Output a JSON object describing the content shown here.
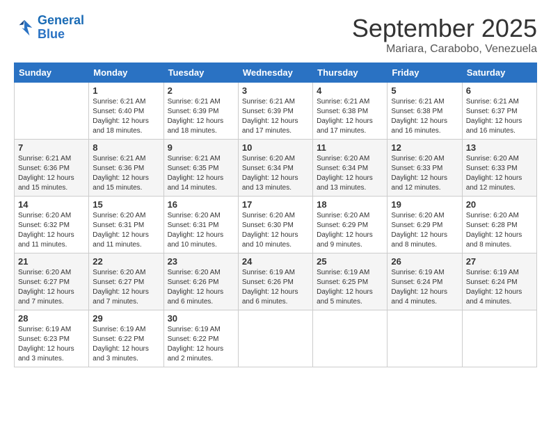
{
  "logo": {
    "line1": "General",
    "line2": "Blue"
  },
  "header": {
    "month": "September 2025",
    "location": "Mariara, Carabobo, Venezuela"
  },
  "columns": [
    "Sunday",
    "Monday",
    "Tuesday",
    "Wednesday",
    "Thursday",
    "Friday",
    "Saturday"
  ],
  "weeks": [
    [
      {
        "day": "",
        "info": ""
      },
      {
        "day": "1",
        "info": "Sunrise: 6:21 AM\nSunset: 6:40 PM\nDaylight: 12 hours\nand 18 minutes."
      },
      {
        "day": "2",
        "info": "Sunrise: 6:21 AM\nSunset: 6:39 PM\nDaylight: 12 hours\nand 18 minutes."
      },
      {
        "day": "3",
        "info": "Sunrise: 6:21 AM\nSunset: 6:39 PM\nDaylight: 12 hours\nand 17 minutes."
      },
      {
        "day": "4",
        "info": "Sunrise: 6:21 AM\nSunset: 6:38 PM\nDaylight: 12 hours\nand 17 minutes."
      },
      {
        "day": "5",
        "info": "Sunrise: 6:21 AM\nSunset: 6:38 PM\nDaylight: 12 hours\nand 16 minutes."
      },
      {
        "day": "6",
        "info": "Sunrise: 6:21 AM\nSunset: 6:37 PM\nDaylight: 12 hours\nand 16 minutes."
      }
    ],
    [
      {
        "day": "7",
        "info": "Sunrise: 6:21 AM\nSunset: 6:36 PM\nDaylight: 12 hours\nand 15 minutes."
      },
      {
        "day": "8",
        "info": "Sunrise: 6:21 AM\nSunset: 6:36 PM\nDaylight: 12 hours\nand 15 minutes."
      },
      {
        "day": "9",
        "info": "Sunrise: 6:21 AM\nSunset: 6:35 PM\nDaylight: 12 hours\nand 14 minutes."
      },
      {
        "day": "10",
        "info": "Sunrise: 6:20 AM\nSunset: 6:34 PM\nDaylight: 12 hours\nand 13 minutes."
      },
      {
        "day": "11",
        "info": "Sunrise: 6:20 AM\nSunset: 6:34 PM\nDaylight: 12 hours\nand 13 minutes."
      },
      {
        "day": "12",
        "info": "Sunrise: 6:20 AM\nSunset: 6:33 PM\nDaylight: 12 hours\nand 12 minutes."
      },
      {
        "day": "13",
        "info": "Sunrise: 6:20 AM\nSunset: 6:33 PM\nDaylight: 12 hours\nand 12 minutes."
      }
    ],
    [
      {
        "day": "14",
        "info": "Sunrise: 6:20 AM\nSunset: 6:32 PM\nDaylight: 12 hours\nand 11 minutes."
      },
      {
        "day": "15",
        "info": "Sunrise: 6:20 AM\nSunset: 6:31 PM\nDaylight: 12 hours\nand 11 minutes."
      },
      {
        "day": "16",
        "info": "Sunrise: 6:20 AM\nSunset: 6:31 PM\nDaylight: 12 hours\nand 10 minutes."
      },
      {
        "day": "17",
        "info": "Sunrise: 6:20 AM\nSunset: 6:30 PM\nDaylight: 12 hours\nand 10 minutes."
      },
      {
        "day": "18",
        "info": "Sunrise: 6:20 AM\nSunset: 6:29 PM\nDaylight: 12 hours\nand 9 minutes."
      },
      {
        "day": "19",
        "info": "Sunrise: 6:20 AM\nSunset: 6:29 PM\nDaylight: 12 hours\nand 8 minutes."
      },
      {
        "day": "20",
        "info": "Sunrise: 6:20 AM\nSunset: 6:28 PM\nDaylight: 12 hours\nand 8 minutes."
      }
    ],
    [
      {
        "day": "21",
        "info": "Sunrise: 6:20 AM\nSunset: 6:27 PM\nDaylight: 12 hours\nand 7 minutes."
      },
      {
        "day": "22",
        "info": "Sunrise: 6:20 AM\nSunset: 6:27 PM\nDaylight: 12 hours\nand 7 minutes."
      },
      {
        "day": "23",
        "info": "Sunrise: 6:20 AM\nSunset: 6:26 PM\nDaylight: 12 hours\nand 6 minutes."
      },
      {
        "day": "24",
        "info": "Sunrise: 6:19 AM\nSunset: 6:26 PM\nDaylight: 12 hours\nand 6 minutes."
      },
      {
        "day": "25",
        "info": "Sunrise: 6:19 AM\nSunset: 6:25 PM\nDaylight: 12 hours\nand 5 minutes."
      },
      {
        "day": "26",
        "info": "Sunrise: 6:19 AM\nSunset: 6:24 PM\nDaylight: 12 hours\nand 4 minutes."
      },
      {
        "day": "27",
        "info": "Sunrise: 6:19 AM\nSunset: 6:24 PM\nDaylight: 12 hours\nand 4 minutes."
      }
    ],
    [
      {
        "day": "28",
        "info": "Sunrise: 6:19 AM\nSunset: 6:23 PM\nDaylight: 12 hours\nand 3 minutes."
      },
      {
        "day": "29",
        "info": "Sunrise: 6:19 AM\nSunset: 6:22 PM\nDaylight: 12 hours\nand 3 minutes."
      },
      {
        "day": "30",
        "info": "Sunrise: 6:19 AM\nSunset: 6:22 PM\nDaylight: 12 hours\nand 2 minutes."
      },
      {
        "day": "",
        "info": ""
      },
      {
        "day": "",
        "info": ""
      },
      {
        "day": "",
        "info": ""
      },
      {
        "day": "",
        "info": ""
      }
    ]
  ]
}
